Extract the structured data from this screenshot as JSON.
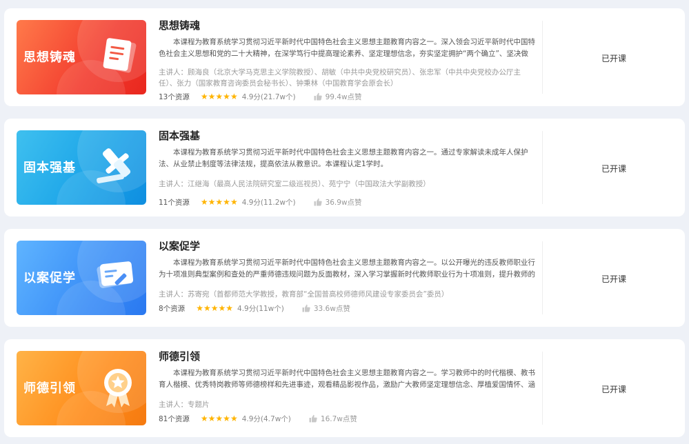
{
  "courses": [
    {
      "cover_text": "思想铸魂",
      "cover_icon": "document-icon",
      "title": "思想铸魂",
      "description": "本课程为教育系统学习贯彻习近平新时代中国特色社会主义思想主题教育内容之一。深入领会习近平新时代中国特色社会主义思想和党的二十大精神，在深学笃行中提高理论素养、坚定理想信念，夯实坚定拥护“两个确立”、坚决做到“两...",
      "lecturer": "主讲人：顾海良（北京大学马克思主义学院教授）、胡敏（中共中央党校研究员）、张忠军（中共中央党校办公厅主任）、张力（国家教育咨询委员会秘书长）、钟秉林（中国教育学会原会长）",
      "resources": "13个资源",
      "rating": 5,
      "score": "4.9分(21.7w个)",
      "likes": "99.4w点赞",
      "status": "已开课"
    },
    {
      "cover_text": "固本强基",
      "cover_icon": "gavel-icon",
      "title": "固本强基",
      "description": "本课程为教育系统学习贯彻习近平新时代中国特色社会主义思想主题教育内容之一。通过专家解读未成年人保护法、从业禁止制度等法律法规，提高依法从教意识。本课程认定1学时。",
      "lecturer": "主讲人：江继海（最高人民法院研究室二级巡视员）、苑宁宁（中国政法大学副教授）",
      "resources": "11个资源",
      "rating": 5,
      "score": "4.9分(11.2w个)",
      "likes": "36.9w点赞",
      "status": "已开课"
    },
    {
      "cover_text": "以案促学",
      "cover_icon": "edit-card-icon",
      "title": "以案促学",
      "description": "本课程为教育系统学习贯彻习近平新时代中国特色社会主义思想主题教育内容之一。以公开曝光的违反教师职业行为十项准则典型案例和查处的严重师德违规问题为反面教材，深入学习掌握新时代教师职业行为十项准则，提升教师的规...",
      "lecturer": "主讲人：苏寄宛（首都师范大学教授，教育部“全国普高校师德师风建设专家委员会”委员）",
      "resources": "8个资源",
      "rating": 5,
      "score": "4.9分(11w个)",
      "likes": "33.6w点赞",
      "status": "已开课"
    },
    {
      "cover_text": "师德引领",
      "cover_icon": "medal-icon",
      "title": "师德引领",
      "description": "本课程为教育系统学习贯彻习近平新时代中国特色社会主义思想主题教育内容之一。学习教师中的时代楷模、教书育人楷模、优秀特岗教师等师德榜样和先进事迹，观看精品影视作品，激励广大教师坚定理想信念、厚植爱国情怀、涵养...",
      "lecturer": "主讲人：专题片",
      "resources": "81个资源",
      "rating": 5,
      "score": "4.9分(4.7w个)",
      "likes": "16.7w点赞",
      "status": "已开课"
    }
  ],
  "colors": {
    "page_bg": "#eef1f7",
    "star": "#ffb400",
    "cover_red": "#f23b2e",
    "cover_blue": "#1aa3e8",
    "cover_light_blue": "#3a8ef7",
    "cover_orange": "#ff8c1a"
  }
}
